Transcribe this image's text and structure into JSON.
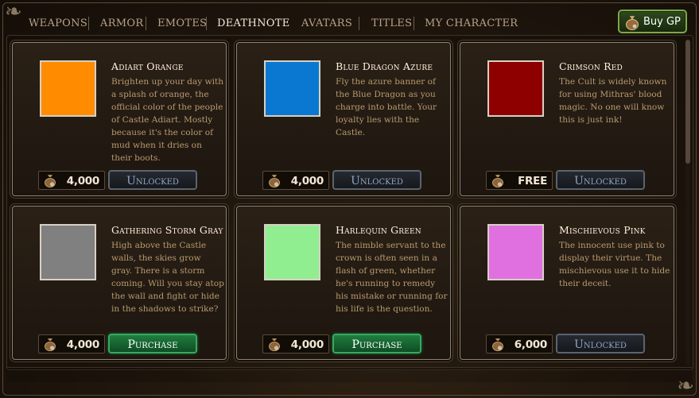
{
  "nav": {
    "tabs": [
      {
        "label": "WEAPONS",
        "active": false
      },
      {
        "label": "ARMOR",
        "active": false
      },
      {
        "label": "EMOTES",
        "active": false
      },
      {
        "label": "DEATHNOTE",
        "active": true
      },
      {
        "label": "AVATARS",
        "active": false
      },
      {
        "label": "TITLES",
        "active": false
      },
      {
        "label": "MY CHARACTER",
        "active": false
      }
    ],
    "buy_gp_label": "Buy GP",
    "buy_gp_icon": "coin-bag-icon"
  },
  "items": [
    {
      "name": "Adiart Orange",
      "color": "#ff8c00",
      "description": "Brighten up your day with a splash of orange, the official color of the people of Castle Adiart. Mostly because it's the color of mud when it dries on their boots.",
      "price": "4,000",
      "action": "Unlocked",
      "action_state": "unlocked",
      "currency_icon": "coin-bag-icon"
    },
    {
      "name": "Blue Dragon Azure",
      "color": "#0a78d0",
      "description": "Fly the azure banner of the Blue Dragon as you charge into battle. Your loyalty lies with the Castle.",
      "price": "4,000",
      "action": "Unlocked",
      "action_state": "unlocked",
      "currency_icon": "coin-bag-icon"
    },
    {
      "name": "Crimson Red",
      "color": "#8e0000",
      "description": "The Cult is widely known for using Mithras' blood magic. No one will know this is just ink!",
      "price": "FREE",
      "action": "Unlocked",
      "action_state": "unlocked",
      "currency_icon": "coin-bag-icon"
    },
    {
      "name": "Gathering Storm Gray",
      "color": "#808080",
      "description": "High above the Castle walls, the skies grow gray. There is a storm coming. Will you stay atop the wall and fight or hide in the shadows to strike?",
      "price": "4,000",
      "action": "Purchase",
      "action_state": "purchase",
      "currency_icon": "coin-bag-icon"
    },
    {
      "name": "Harlequin Green",
      "color": "#90ee90",
      "description": "The nimble servant to the crown is often seen in a flash of green, whether he's running to remedy his mistake or running for his life is the question.",
      "price": "4,000",
      "action": "Purchase",
      "action_state": "purchase",
      "currency_icon": "coin-bag-icon"
    },
    {
      "name": "Mischievous Pink",
      "color": "#e070e0",
      "description": "The innocent use pink to display their virtue. The mischievous use it to hide their deceit.",
      "price": "6,000",
      "action": "Unlocked",
      "action_state": "unlocked",
      "currency_icon": "coin-bag-icon"
    }
  ]
}
